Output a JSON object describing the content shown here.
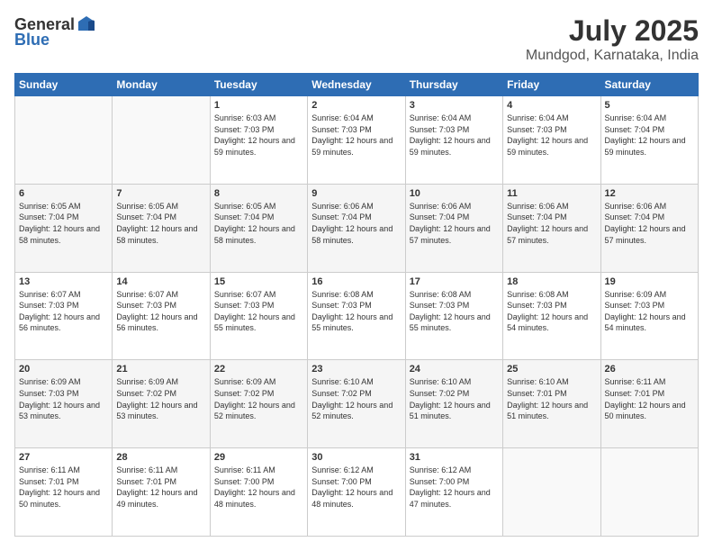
{
  "header": {
    "logo_general": "General",
    "logo_blue": "Blue",
    "month": "July 2025",
    "location": "Mundgod, Karnataka, India"
  },
  "weekdays": [
    "Sunday",
    "Monday",
    "Tuesday",
    "Wednesday",
    "Thursday",
    "Friday",
    "Saturday"
  ],
  "weeks": [
    [
      {
        "day": "",
        "sunrise": "",
        "sunset": "",
        "daylight": ""
      },
      {
        "day": "",
        "sunrise": "",
        "sunset": "",
        "daylight": ""
      },
      {
        "day": "1",
        "sunrise": "Sunrise: 6:03 AM",
        "sunset": "Sunset: 7:03 PM",
        "daylight": "Daylight: 12 hours and 59 minutes."
      },
      {
        "day": "2",
        "sunrise": "Sunrise: 6:04 AM",
        "sunset": "Sunset: 7:03 PM",
        "daylight": "Daylight: 12 hours and 59 minutes."
      },
      {
        "day": "3",
        "sunrise": "Sunrise: 6:04 AM",
        "sunset": "Sunset: 7:03 PM",
        "daylight": "Daylight: 12 hours and 59 minutes."
      },
      {
        "day": "4",
        "sunrise": "Sunrise: 6:04 AM",
        "sunset": "Sunset: 7:03 PM",
        "daylight": "Daylight: 12 hours and 59 minutes."
      },
      {
        "day": "5",
        "sunrise": "Sunrise: 6:04 AM",
        "sunset": "Sunset: 7:04 PM",
        "daylight": "Daylight: 12 hours and 59 minutes."
      }
    ],
    [
      {
        "day": "6",
        "sunrise": "Sunrise: 6:05 AM",
        "sunset": "Sunset: 7:04 PM",
        "daylight": "Daylight: 12 hours and 58 minutes."
      },
      {
        "day": "7",
        "sunrise": "Sunrise: 6:05 AM",
        "sunset": "Sunset: 7:04 PM",
        "daylight": "Daylight: 12 hours and 58 minutes."
      },
      {
        "day": "8",
        "sunrise": "Sunrise: 6:05 AM",
        "sunset": "Sunset: 7:04 PM",
        "daylight": "Daylight: 12 hours and 58 minutes."
      },
      {
        "day": "9",
        "sunrise": "Sunrise: 6:06 AM",
        "sunset": "Sunset: 7:04 PM",
        "daylight": "Daylight: 12 hours and 58 minutes."
      },
      {
        "day": "10",
        "sunrise": "Sunrise: 6:06 AM",
        "sunset": "Sunset: 7:04 PM",
        "daylight": "Daylight: 12 hours and 57 minutes."
      },
      {
        "day": "11",
        "sunrise": "Sunrise: 6:06 AM",
        "sunset": "Sunset: 7:04 PM",
        "daylight": "Daylight: 12 hours and 57 minutes."
      },
      {
        "day": "12",
        "sunrise": "Sunrise: 6:06 AM",
        "sunset": "Sunset: 7:04 PM",
        "daylight": "Daylight: 12 hours and 57 minutes."
      }
    ],
    [
      {
        "day": "13",
        "sunrise": "Sunrise: 6:07 AM",
        "sunset": "Sunset: 7:03 PM",
        "daylight": "Daylight: 12 hours and 56 minutes."
      },
      {
        "day": "14",
        "sunrise": "Sunrise: 6:07 AM",
        "sunset": "Sunset: 7:03 PM",
        "daylight": "Daylight: 12 hours and 56 minutes."
      },
      {
        "day": "15",
        "sunrise": "Sunrise: 6:07 AM",
        "sunset": "Sunset: 7:03 PM",
        "daylight": "Daylight: 12 hours and 55 minutes."
      },
      {
        "day": "16",
        "sunrise": "Sunrise: 6:08 AM",
        "sunset": "Sunset: 7:03 PM",
        "daylight": "Daylight: 12 hours and 55 minutes."
      },
      {
        "day": "17",
        "sunrise": "Sunrise: 6:08 AM",
        "sunset": "Sunset: 7:03 PM",
        "daylight": "Daylight: 12 hours and 55 minutes."
      },
      {
        "day": "18",
        "sunrise": "Sunrise: 6:08 AM",
        "sunset": "Sunset: 7:03 PM",
        "daylight": "Daylight: 12 hours and 54 minutes."
      },
      {
        "day": "19",
        "sunrise": "Sunrise: 6:09 AM",
        "sunset": "Sunset: 7:03 PM",
        "daylight": "Daylight: 12 hours and 54 minutes."
      }
    ],
    [
      {
        "day": "20",
        "sunrise": "Sunrise: 6:09 AM",
        "sunset": "Sunset: 7:03 PM",
        "daylight": "Daylight: 12 hours and 53 minutes."
      },
      {
        "day": "21",
        "sunrise": "Sunrise: 6:09 AM",
        "sunset": "Sunset: 7:02 PM",
        "daylight": "Daylight: 12 hours and 53 minutes."
      },
      {
        "day": "22",
        "sunrise": "Sunrise: 6:09 AM",
        "sunset": "Sunset: 7:02 PM",
        "daylight": "Daylight: 12 hours and 52 minutes."
      },
      {
        "day": "23",
        "sunrise": "Sunrise: 6:10 AM",
        "sunset": "Sunset: 7:02 PM",
        "daylight": "Daylight: 12 hours and 52 minutes."
      },
      {
        "day": "24",
        "sunrise": "Sunrise: 6:10 AM",
        "sunset": "Sunset: 7:02 PM",
        "daylight": "Daylight: 12 hours and 51 minutes."
      },
      {
        "day": "25",
        "sunrise": "Sunrise: 6:10 AM",
        "sunset": "Sunset: 7:01 PM",
        "daylight": "Daylight: 12 hours and 51 minutes."
      },
      {
        "day": "26",
        "sunrise": "Sunrise: 6:11 AM",
        "sunset": "Sunset: 7:01 PM",
        "daylight": "Daylight: 12 hours and 50 minutes."
      }
    ],
    [
      {
        "day": "27",
        "sunrise": "Sunrise: 6:11 AM",
        "sunset": "Sunset: 7:01 PM",
        "daylight": "Daylight: 12 hours and 50 minutes."
      },
      {
        "day": "28",
        "sunrise": "Sunrise: 6:11 AM",
        "sunset": "Sunset: 7:01 PM",
        "daylight": "Daylight: 12 hours and 49 minutes."
      },
      {
        "day": "29",
        "sunrise": "Sunrise: 6:11 AM",
        "sunset": "Sunset: 7:00 PM",
        "daylight": "Daylight: 12 hours and 48 minutes."
      },
      {
        "day": "30",
        "sunrise": "Sunrise: 6:12 AM",
        "sunset": "Sunset: 7:00 PM",
        "daylight": "Daylight: 12 hours and 48 minutes."
      },
      {
        "day": "31",
        "sunrise": "Sunrise: 6:12 AM",
        "sunset": "Sunset: 7:00 PM",
        "daylight": "Daylight: 12 hours and 47 minutes."
      },
      {
        "day": "",
        "sunrise": "",
        "sunset": "",
        "daylight": ""
      },
      {
        "day": "",
        "sunrise": "",
        "sunset": "",
        "daylight": ""
      }
    ]
  ]
}
